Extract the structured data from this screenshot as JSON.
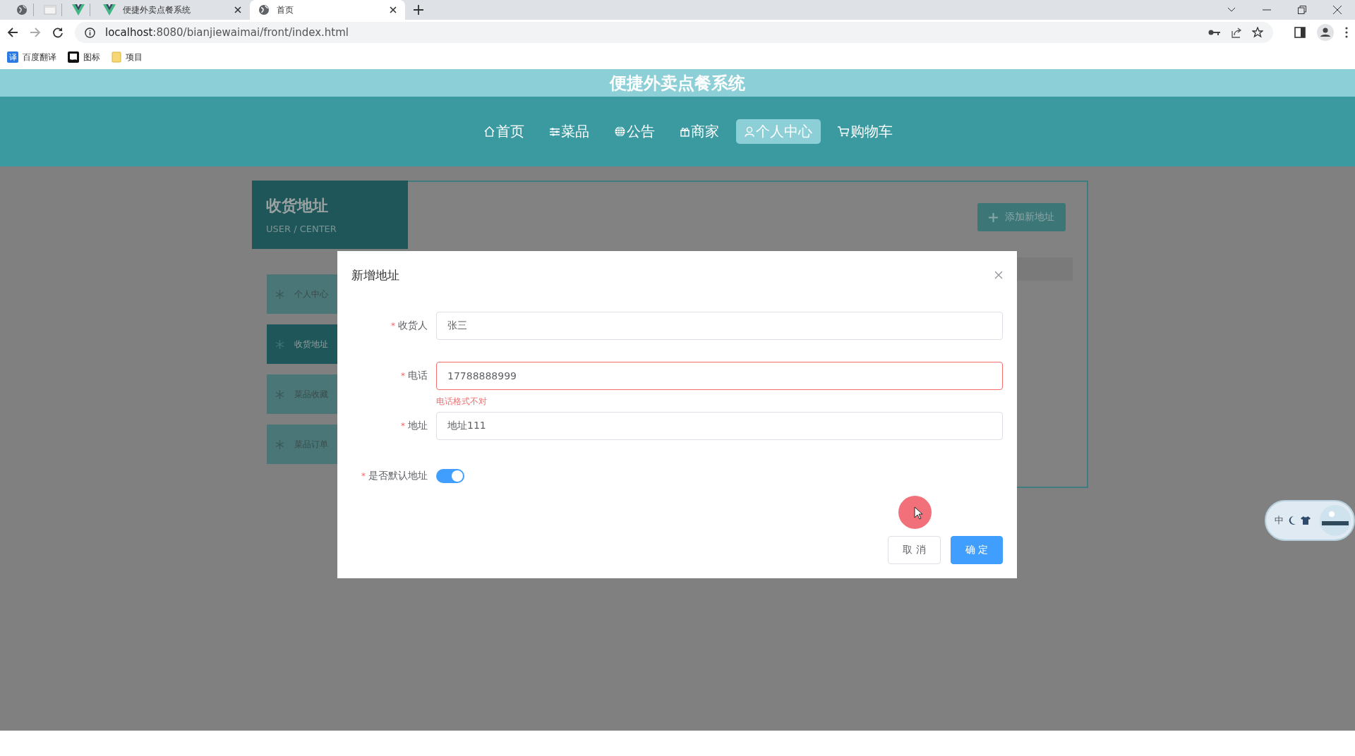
{
  "browser": {
    "tabs": [
      {
        "kind": "icon",
        "selected": false
      },
      {
        "kind": "icon",
        "selected": false
      },
      {
        "kind": "icon",
        "selected": false
      },
      {
        "kind": "page",
        "title": "便捷外卖点餐系统",
        "selected": false
      },
      {
        "kind": "page",
        "title": "首页",
        "selected": true
      }
    ],
    "url_host": "localhost",
    "url_path": ":8080/bianjiewaimai/front/index.html",
    "bookmarks": [
      {
        "kind": "translate",
        "label": "百度翻译",
        "badge": "译"
      },
      {
        "kind": "flag",
        "label": "图标"
      },
      {
        "kind": "folder",
        "label": "项目"
      }
    ]
  },
  "site_title": "便捷外卖点餐系统",
  "nav": [
    {
      "label": "首页",
      "selected": false
    },
    {
      "label": "菜品",
      "selected": false
    },
    {
      "label": "公告",
      "selected": false
    },
    {
      "label": "商家",
      "selected": false
    },
    {
      "label": "个人中心",
      "selected": true
    },
    {
      "label": "购物车",
      "selected": false
    }
  ],
  "section": {
    "title": "收货地址",
    "subtitle": "USER / CENTER"
  },
  "sidebar": {
    "items": [
      {
        "label": "个人中心",
        "selected": false
      },
      {
        "label": "收货地址",
        "selected": true
      },
      {
        "label": "菜品收藏",
        "selected": false
      },
      {
        "label": "菜品订单",
        "selected": false
      }
    ]
  },
  "add_button": "添加新地址",
  "dialog": {
    "title": "新增地址",
    "fields": [
      {
        "mark": "*",
        "label": "收货人",
        "value": "张三"
      },
      {
        "mark": "*",
        "label": "电话",
        "value": "17788888999",
        "error": "电话格式不对"
      },
      {
        "mark": "*",
        "label": "地址",
        "value": "地址111"
      }
    ],
    "default_switch": {
      "mark": "*",
      "label": "是否默认地址",
      "on": true
    },
    "buttons": [
      {
        "kind": "default",
        "label": "取 消"
      },
      {
        "kind": "primary",
        "label": "确 定"
      }
    ]
  },
  "ime_widget": {
    "label": "中"
  }
}
